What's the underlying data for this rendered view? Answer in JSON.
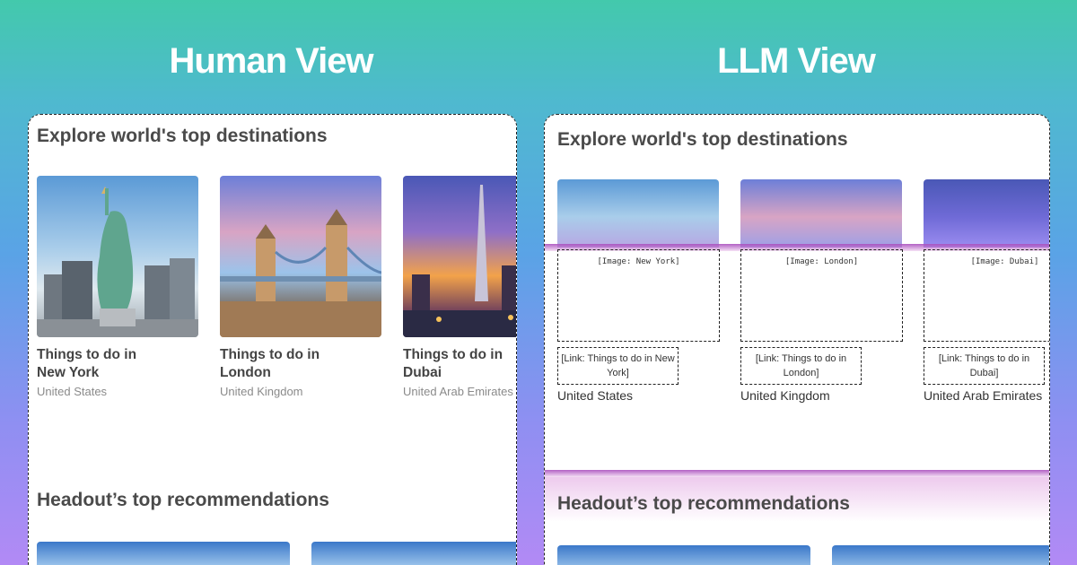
{
  "headings": {
    "left": "Human View",
    "right": "LLM View"
  },
  "human": {
    "section_title": "Explore world's top destinations",
    "cards": [
      {
        "title": "Things to do in New York",
        "sub": "United States"
      },
      {
        "title": "Things to do in London",
        "sub": "United Kingdom"
      },
      {
        "title": "Things to do in Dubai",
        "sub": "United Arab Emirates"
      }
    ],
    "section2_title": "Headout’s top recommendations"
  },
  "llm": {
    "section_title": "Explore world's top destinations",
    "cards": [
      {
        "image_label": "[Image: New York]",
        "link_label": "[Link: Things to do in New York]",
        "sub": "United States"
      },
      {
        "image_label": "[Image: London]",
        "link_label": "[Link: Things to do in London]",
        "sub": "United Kingdom"
      },
      {
        "image_label": "[Image: Dubai]",
        "link_label": "[Link: Things to do in Dubai]",
        "sub": "United Arab Emirates"
      }
    ],
    "section2_title": "Headout’s top recommendations"
  }
}
